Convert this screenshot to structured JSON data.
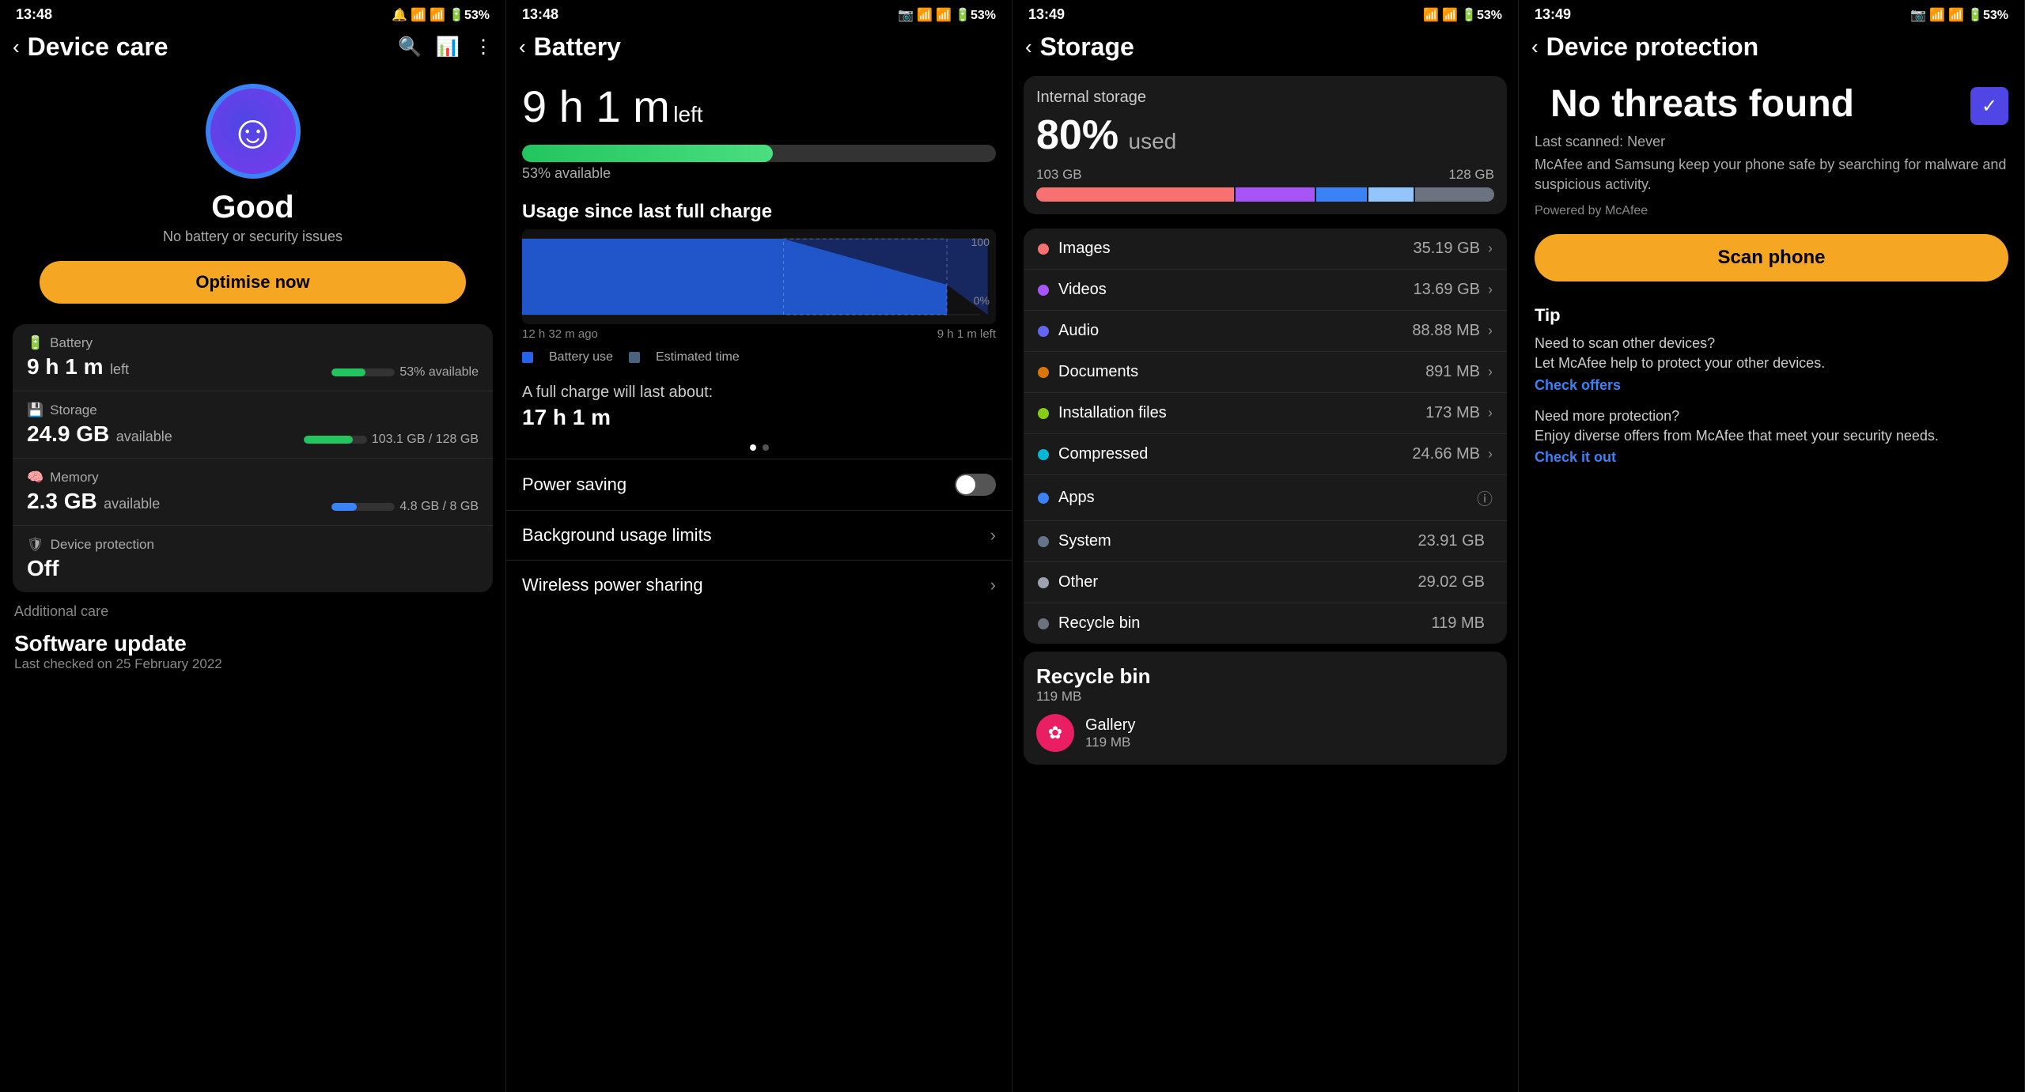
{
  "panel1": {
    "status_time": "13:48",
    "status_icons": "🔔 📶 📶 🔋53%",
    "nav_back": "‹",
    "nav_title": "Device care",
    "hero_icon": "😊",
    "hero_status": "Good",
    "hero_subtitle": "No battery or security issues",
    "optimise_btn": "Optimise now",
    "battery_label": "Battery",
    "battery_icon": "🔋",
    "battery_value": "9 h 1 m",
    "battery_unit": "left",
    "battery_sub": "53% available",
    "storage_label": "Storage",
    "storage_icon": "💾",
    "storage_value": "24.9 GB",
    "storage_unit": "available",
    "storage_sub": "103.1 GB / 128 GB",
    "memory_label": "Memory",
    "memory_icon": "🧠",
    "memory_value": "2.3 GB",
    "memory_unit": "available",
    "memory_sub": "4.8 GB / 8 GB",
    "protection_label": "Device protection",
    "protection_icon": "🛡",
    "protection_value": "Off",
    "additional_care": "Additional care",
    "software_title": "Software update",
    "software_sub": "Last checked on 25 February 2022"
  },
  "panel2": {
    "status_time": "13:48",
    "nav_title": "Battery",
    "battery_time_h": "9 h 1 m",
    "battery_left": "left",
    "battery_pct": "53% available",
    "usage_title": "Usage since last full charge",
    "chart_label_start": "12 h 32 m ago",
    "chart_label_end": "9 h 1 m left",
    "chart_100": "100",
    "chart_0": "0%",
    "legend_battery": "Battery use",
    "legend_estimated": "Estimated time",
    "full_charge_title": "A full charge will last about:",
    "full_charge_time": "17 h 1 m",
    "power_saving": "Power saving",
    "bg_usage": "Background usage limits",
    "wireless_power": "Wireless power sharing"
  },
  "panel3": {
    "status_time": "13:49",
    "nav_title": "Storage",
    "internal_label": "Internal storage",
    "used_pct": "80%",
    "used_label": "used",
    "storage_min": "103 GB",
    "storage_max": "128 GB",
    "items": [
      {
        "name": "Images",
        "size": "35.19 GB",
        "color": "#f87171",
        "has_chevron": true
      },
      {
        "name": "Videos",
        "size": "13.69 GB",
        "color": "#a855f7",
        "has_chevron": true
      },
      {
        "name": "Audio",
        "size": "88.88 MB",
        "color": "#6366f1",
        "has_chevron": true
      },
      {
        "name": "Documents",
        "size": "891 MB",
        "color": "#d97706",
        "has_chevron": true
      },
      {
        "name": "Installation files",
        "size": "173 MB",
        "color": "#84cc16",
        "has_chevron": true
      },
      {
        "name": "Compressed",
        "size": "24.66 MB",
        "color": "#06b6d4",
        "has_chevron": true
      },
      {
        "name": "Apps",
        "size": "",
        "color": "#3b82f6",
        "has_info": true
      },
      {
        "name": "System",
        "size": "23.91 GB",
        "color": "#64748b",
        "has_chevron": false
      },
      {
        "name": "Other",
        "size": "29.02 GB",
        "color": "#9ca3af",
        "has_chevron": false
      },
      {
        "name": "Recycle bin",
        "size": "119 MB",
        "color": "#6b7280",
        "has_chevron": false
      }
    ],
    "recycle_title": "Recycle bin",
    "recycle_sub": "119 MB",
    "recycle_app": "Gallery",
    "recycle_app_size": "119 MB"
  },
  "panel4": {
    "status_time": "13:49",
    "nav_title": "Device protection",
    "main_title": "No threats found",
    "last_scanned": "Last scanned: Never",
    "description": "McAfee and Samsung keep your phone safe by searching for malware and suspicious activity.",
    "powered_by": "Powered by McAfee",
    "scan_btn": "Scan phone",
    "tip_label": "Tip",
    "tip1_title": "Need to scan other devices?",
    "tip1_text": "Let McAfee help to protect your other devices.",
    "tip1_link": "Check offers",
    "tip2_title": "Need more protection?",
    "tip2_text": "Enjoy diverse offers from McAfee that meet your security needs.",
    "tip2_link": "Check it out"
  }
}
